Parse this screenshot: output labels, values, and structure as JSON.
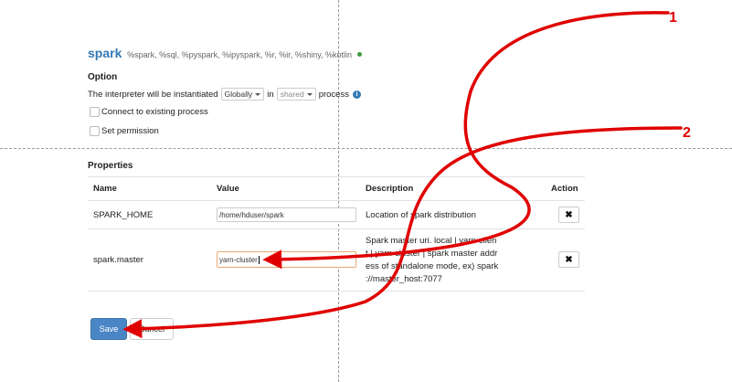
{
  "interpreter": {
    "name": "spark",
    "bindings": "%spark, %sql, %pyspark, %ipyspark, %r, %ir, %shiny, %kotlin",
    "status_color": "#3c9a3c"
  },
  "option": {
    "heading": "Option",
    "sentence_prefix": "The interpreter will be instantiated",
    "scope_value": "Globally",
    "in_word": "in",
    "mode_value": "shared",
    "sentence_suffix": "process",
    "info_icon": "i",
    "connect_label": "Connect to existing process",
    "permission_label": "Set permission"
  },
  "properties": {
    "heading": "Properties",
    "columns": {
      "name": "Name",
      "value": "Value",
      "description": "Description",
      "action": "Action"
    },
    "rows": [
      {
        "name": "SPARK_HOME",
        "value": "/home/hduser/spark",
        "description": "Location of spark distribution",
        "action_icon": "✖"
      },
      {
        "name": "spark.master",
        "value": "yarn-cluster",
        "description_lines": [
          "Spark master uri. local | yarn-clien",
          "t | yarn-cluster | spark master addr",
          "ess of standalone mode, ex) spark",
          "://master_host:7077"
        ],
        "action_icon": "✖"
      }
    ]
  },
  "actions": {
    "save_label": "Save",
    "cancel_label": "Cancel"
  },
  "annotations": {
    "color": "#e00000",
    "markers": [
      "1",
      "2"
    ]
  }
}
